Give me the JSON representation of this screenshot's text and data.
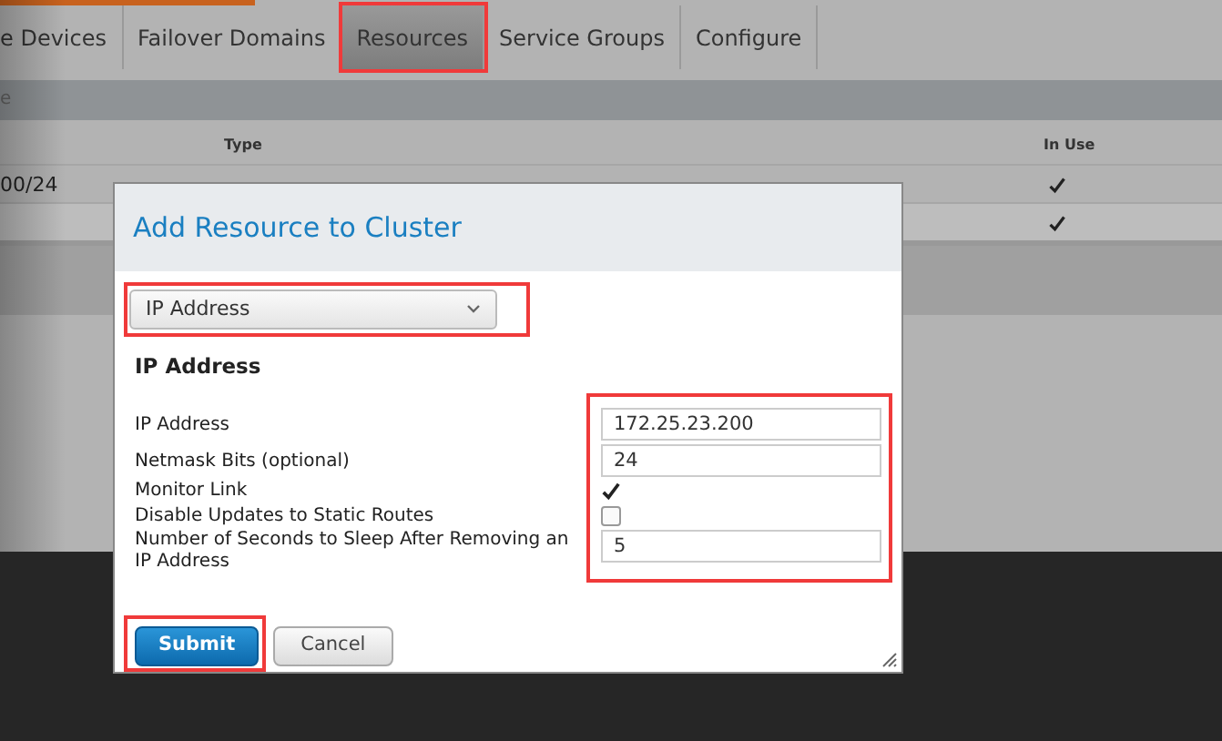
{
  "nav_tabs": [
    {
      "label": "e Devices",
      "selected": false,
      "highlighted": false
    },
    {
      "label": "Failover Domains",
      "selected": false,
      "highlighted": false
    },
    {
      "label": "Resources",
      "selected": true,
      "highlighted": true
    },
    {
      "label": "Service Groups",
      "selected": false,
      "highlighted": false
    },
    {
      "label": "Configure",
      "selected": false,
      "highlighted": false
    }
  ],
  "toolbar": {
    "text": "e"
  },
  "table": {
    "columns": [
      {
        "label": "Type"
      },
      {
        "label": "In Use"
      }
    ],
    "rows": [
      {
        "name": "00/24",
        "in_use": true
      },
      {
        "in_use": true
      }
    ]
  },
  "dialog": {
    "title": "Add Resource to Cluster",
    "resource_type": {
      "value": "IP Address",
      "highlighted": true
    },
    "section_title": "IP Address",
    "fields_highlighted": true,
    "fields": [
      {
        "kind": "text",
        "label": "IP Address",
        "value": "172.25.23.200"
      },
      {
        "kind": "text",
        "label": "Netmask Bits (optional)",
        "value": "24"
      },
      {
        "kind": "checkbox",
        "label": "Monitor Link",
        "checked": true
      },
      {
        "kind": "checkbox",
        "label": "Disable Updates to Static Routes",
        "checked": false
      },
      {
        "kind": "text",
        "label": "Number of Seconds to Sleep After Removing an IP Address",
        "value": "5"
      }
    ],
    "buttons": [
      {
        "label": "Submit",
        "kind": "primary",
        "highlighted": true
      },
      {
        "label": "Cancel",
        "kind": "secondary",
        "highlighted": false
      }
    ]
  }
}
